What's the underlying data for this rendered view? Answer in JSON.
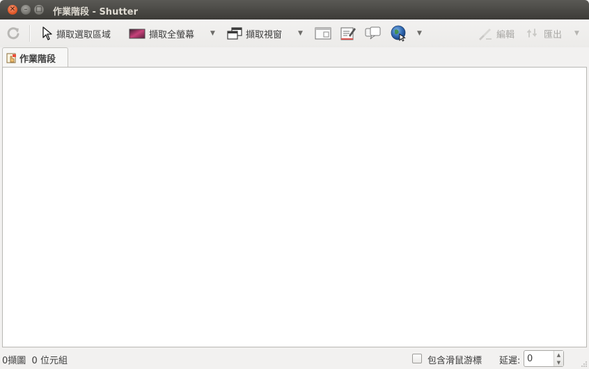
{
  "window": {
    "title": "作業階段 - Shutter"
  },
  "toolbar": {
    "capture_selection_label": "擷取選取區域",
    "capture_desktop_label": "擷取全螢幕",
    "capture_window_label": "擷取視窗",
    "edit_label": "編輯",
    "export_label": "匯出",
    "dropdown_glyph": "▼"
  },
  "tabs": [
    {
      "label": "作業階段"
    }
  ],
  "statusbar": {
    "summary": "0擷圖  0 位元組",
    "include_cursor_label": "包含滑鼠游標",
    "delay_label": "延遲:",
    "delay_value": "0"
  },
  "colors": {
    "titlebar": "#3c3b37",
    "title_text": "#dfdbd2",
    "close_button": "#e25b2b",
    "window_bg": "#f2f1f0",
    "content_bg": "#ffffff"
  },
  "icons": {
    "refresh": "refresh-icon",
    "selection": "pointer-arrow-icon",
    "desktop": "desktop-screenshot-icon",
    "window": "window-capture-icon",
    "menu": "menu-capture-icon",
    "tooltip": "tooltip-capture-icon",
    "web": "globe-web-icon",
    "edit": "edit-draw-icon",
    "export": "export-arrows-icon",
    "session": "session-hand-icon"
  }
}
